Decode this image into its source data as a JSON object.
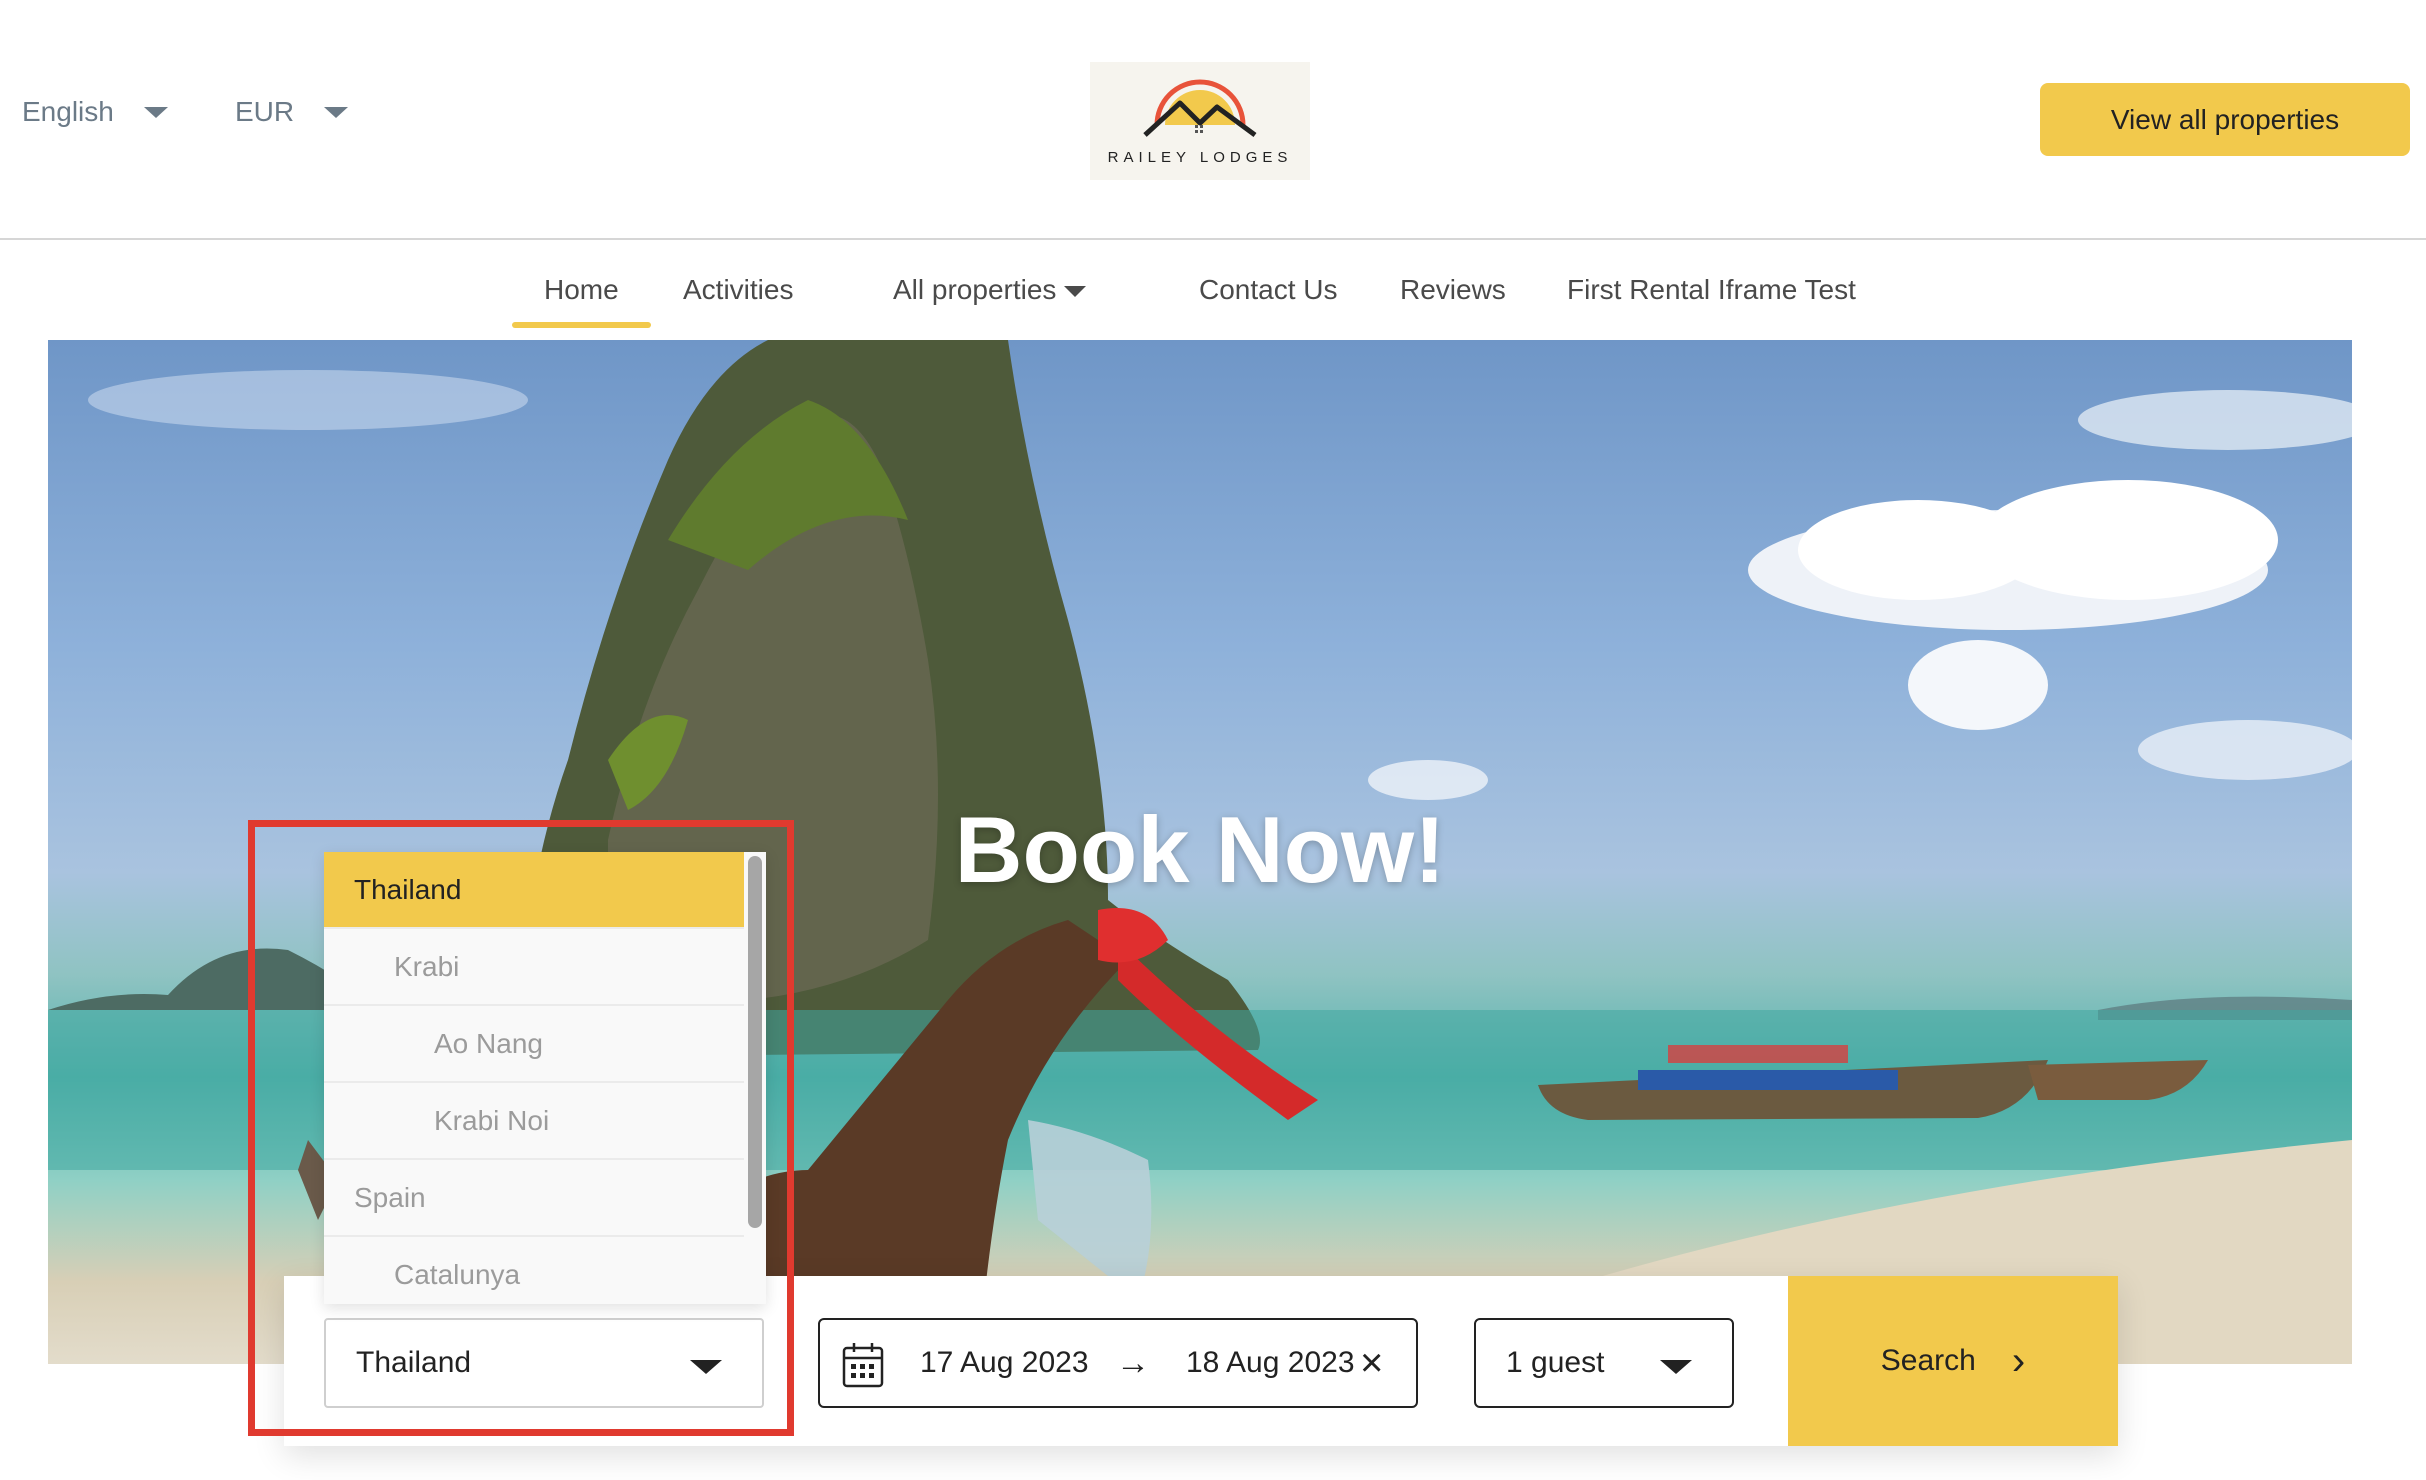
{
  "header": {
    "language": "English",
    "currency": "EUR",
    "logo_text": "RAILEY LODGES",
    "view_all_label": "View all properties"
  },
  "nav": {
    "items": [
      {
        "label": "Home",
        "active": true
      },
      {
        "label": "Activities"
      },
      {
        "label": "All properties",
        "has_dropdown": true
      },
      {
        "label": "Contact Us"
      },
      {
        "label": "Reviews"
      },
      {
        "label": "First Rental Iframe Test"
      }
    ]
  },
  "hero": {
    "title": "Book Now!"
  },
  "location_dropdown": {
    "options": [
      {
        "label": "Thailand",
        "level": 0,
        "selected": true
      },
      {
        "label": "Krabi",
        "level": 1
      },
      {
        "label": "Ao Nang",
        "level": 2
      },
      {
        "label": "Krabi Noi",
        "level": 2
      },
      {
        "label": "Spain",
        "level": 0
      },
      {
        "label": "Catalunya",
        "level": 1
      }
    ]
  },
  "search": {
    "location_value": "Thailand",
    "checkin": "17 Aug 2023",
    "checkout": "18 Aug 2023",
    "arrow": "→",
    "clear": "×",
    "guests": "1 guest",
    "button_label": "Search",
    "button_chevron": "›"
  },
  "colors": {
    "accent": "#f2c94c",
    "highlight": "#e03a2f"
  }
}
